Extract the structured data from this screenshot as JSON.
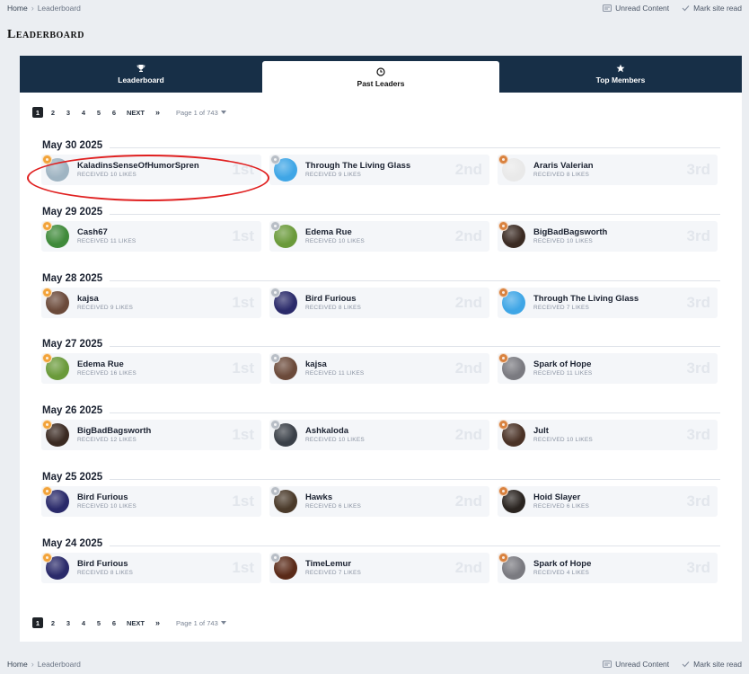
{
  "breadcrumb": {
    "home": "Home",
    "current": "Leaderboard"
  },
  "site_actions": {
    "unread": "Unread Content",
    "mark_read": "Mark site read"
  },
  "page_title": "Leaderboard",
  "tabs": [
    {
      "label": "Leaderboard",
      "icon": "trophy-icon"
    },
    {
      "label": "Past Leaders",
      "icon": "clock-icon"
    },
    {
      "label": "Top Members",
      "icon": "star-icon"
    }
  ],
  "pagination": {
    "pages": [
      "1",
      "2",
      "3",
      "4",
      "5",
      "6"
    ],
    "current": "1",
    "next": "NEXT",
    "last": "»",
    "page_of": "Page 1 of 743"
  },
  "colors": {
    "gold": "#f2a33a",
    "silver": "#b8bec6",
    "bronze": "#d9823f",
    "tabbar": "#172f47",
    "highlight": "#e02020"
  },
  "days": [
    {
      "date": "May 30 2025",
      "entries": [
        {
          "rank": "1st",
          "name": "KaladinsSenseOfHumorSpren",
          "likes": "RECEIVED 10 LIKES",
          "avatar": "#9fb4c2"
        },
        {
          "rank": "2nd",
          "name": "Through The Living Glass",
          "likes": "RECEIVED 9 LIKES",
          "avatar": "#3fa6e6"
        },
        {
          "rank": "3rd",
          "name": "Araris Valerian",
          "likes": "RECEIVED 8 LIKES",
          "avatar": "#e9e9e9"
        }
      ]
    },
    {
      "date": "May 29 2025",
      "entries": [
        {
          "rank": "1st",
          "name": "Cash67",
          "likes": "RECEIVED 11 LIKES",
          "avatar": "#3f8a3a"
        },
        {
          "rank": "2nd",
          "name": "Edema Rue",
          "likes": "RECEIVED 10 LIKES",
          "avatar": "#6a9a3a"
        },
        {
          "rank": "3rd",
          "name": "BigBadBagsworth",
          "likes": "RECEIVED 10 LIKES",
          "avatar": "#3a2a22"
        }
      ]
    },
    {
      "date": "May 28 2025",
      "entries": [
        {
          "rank": "1st",
          "name": "kajsa",
          "likes": "RECEIVED 9 LIKES",
          "avatar": "#6b4a3a"
        },
        {
          "rank": "2nd",
          "name": "Bird Furious",
          "likes": "RECEIVED 8 LIKES",
          "avatar": "#2a2a6a"
        },
        {
          "rank": "3rd",
          "name": "Through The Living Glass",
          "likes": "RECEIVED 7 LIKES",
          "avatar": "#3fa6e6"
        }
      ]
    },
    {
      "date": "May 27 2025",
      "entries": [
        {
          "rank": "1st",
          "name": "Edema Rue",
          "likes": "RECEIVED 16 LIKES",
          "avatar": "#6a9a3a"
        },
        {
          "rank": "2nd",
          "name": "kajsa",
          "likes": "RECEIVED 11 LIKES",
          "avatar": "#6b4a3a"
        },
        {
          "rank": "3rd",
          "name": "Spark of Hope",
          "likes": "RECEIVED 11 LIKES",
          "avatar": "#7a7a80"
        }
      ]
    },
    {
      "date": "May 26 2025",
      "entries": [
        {
          "rank": "1st",
          "name": "BigBadBagsworth",
          "likes": "RECEIVED 12 LIKES",
          "avatar": "#3a2a22"
        },
        {
          "rank": "2nd",
          "name": "Ashkaloda",
          "likes": "RECEIVED 10 LIKES",
          "avatar": "#3a4048"
        },
        {
          "rank": "3rd",
          "name": "Jult",
          "likes": "RECEIVED 10 LIKES",
          "avatar": "#4a3226"
        }
      ]
    },
    {
      "date": "May 25 2025",
      "entries": [
        {
          "rank": "1st",
          "name": "Bird Furious",
          "likes": "RECEIVED 10 LIKES",
          "avatar": "#2a2a6a"
        },
        {
          "rank": "2nd",
          "name": "Hawks",
          "likes": "RECEIVED 6 LIKES",
          "avatar": "#4a3a2a"
        },
        {
          "rank": "3rd",
          "name": "Hoid Slayer",
          "likes": "RECEIVED 6 LIKES",
          "avatar": "#2a2420"
        }
      ]
    },
    {
      "date": "May 24 2025",
      "entries": [
        {
          "rank": "1st",
          "name": "Bird Furious",
          "likes": "RECEIVED 8 LIKES",
          "avatar": "#2a2a6a"
        },
        {
          "rank": "2nd",
          "name": "TimeLemur",
          "likes": "RECEIVED 7 LIKES",
          "avatar": "#5a2a18"
        },
        {
          "rank": "3rd",
          "name": "Spark of Hope",
          "likes": "RECEIVED 4 LIKES",
          "avatar": "#7a7a80"
        }
      ]
    }
  ]
}
